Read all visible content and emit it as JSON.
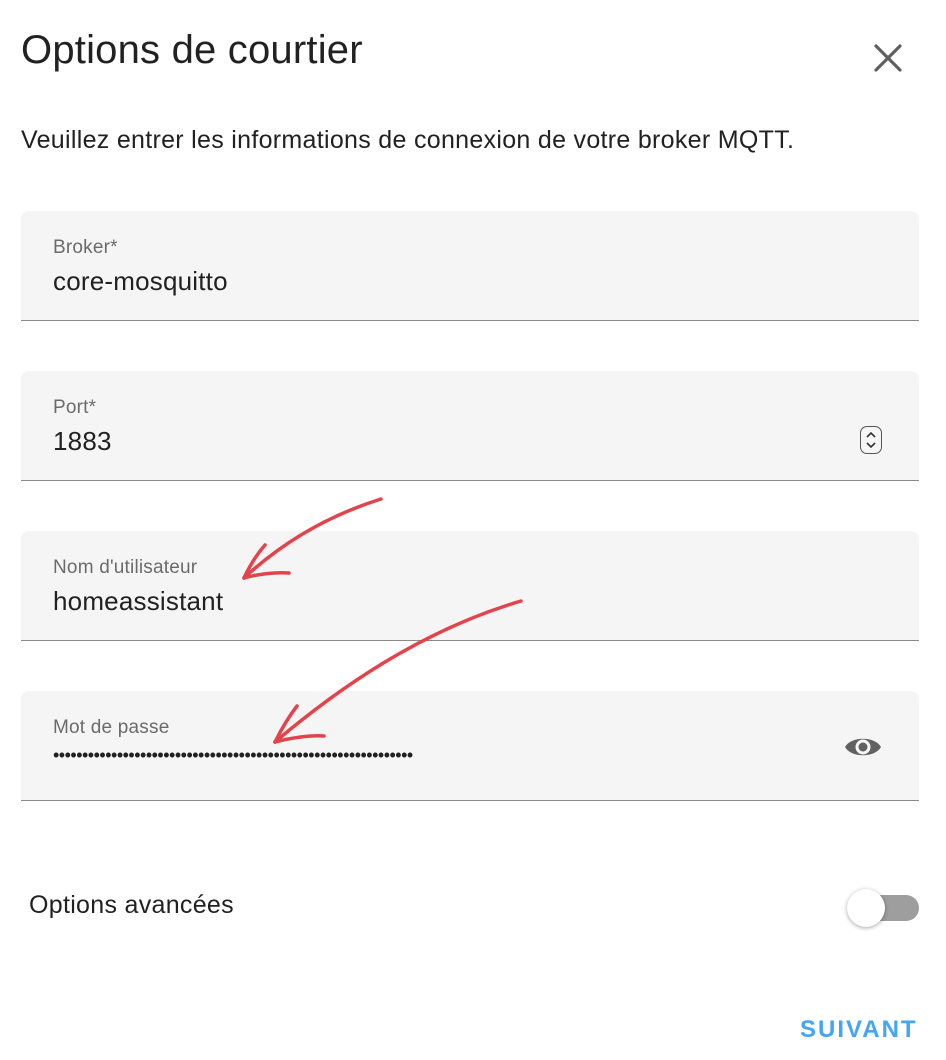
{
  "dialog": {
    "title": "Options de courtier",
    "description": "Veuillez entrer les informations de connexion de votre broker MQTT."
  },
  "fields": {
    "broker": {
      "label": "Broker*",
      "value": "core-mosquitto"
    },
    "port": {
      "label": "Port*",
      "value": "1883"
    },
    "username": {
      "label": "Nom d'utilisateur",
      "value": "homeassistant"
    },
    "password": {
      "label": "Mot de passe",
      "masked_value": "••••••••••••••••••••••••••••••••••••••••••••••••••••••••••••••"
    }
  },
  "advanced": {
    "label": "Options avancées",
    "enabled": false
  },
  "actions": {
    "next_label": "SUIVANT"
  },
  "icons": {
    "close": "close-icon",
    "stepper": "number-stepper-icon",
    "visibility": "eye-icon"
  },
  "colors": {
    "accent": "#42a5f5",
    "annotation": "#e5434b",
    "field_bg": "#f5f5f5"
  }
}
